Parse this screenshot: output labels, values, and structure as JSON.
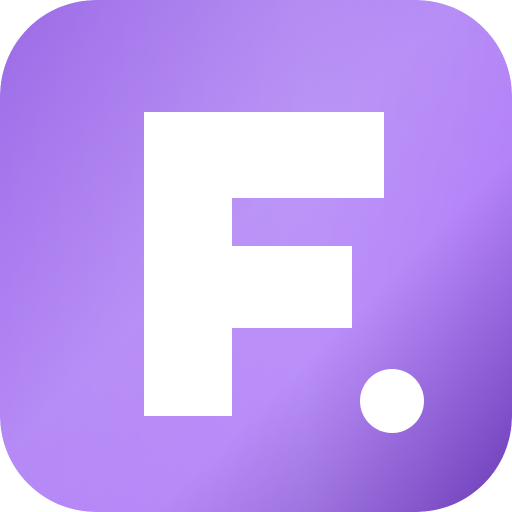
{
  "icon": {
    "name": "F. app icon",
    "glyph": "F",
    "accent_dot": true,
    "colors": {
      "gradient_start": "#9b6be6",
      "gradient_mid": "#b58af6",
      "gradient_light": "#b383f8",
      "gradient_end": "#6a3bb6",
      "glyph": "#ffffff"
    }
  }
}
